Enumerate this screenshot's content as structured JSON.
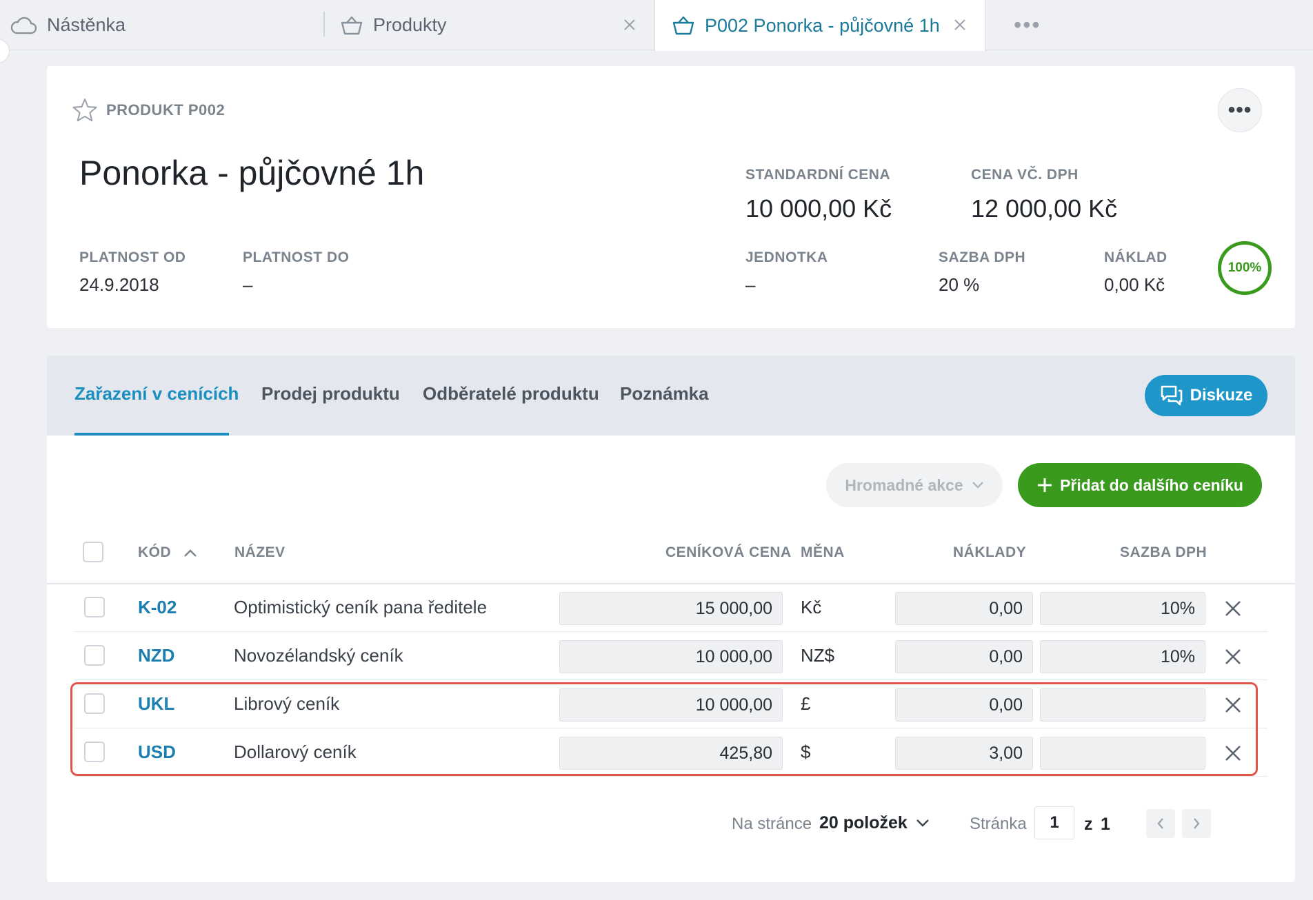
{
  "tabs": {
    "dashboard": "Nástěnka",
    "products": "Produkty",
    "active": "P002 Ponorka - půjčovné 1h",
    "more": "•••"
  },
  "header": {
    "breadcrumb": "PRODUKT P002",
    "more": "•••",
    "title": "Ponorka - půjčovné 1h",
    "standard_price_label": "STANDARDNÍ CENA",
    "standard_price": "10 000,00 Kč",
    "price_vat_label": "CENA VČ. DPH",
    "price_vat": "12 000,00 Kč",
    "valid_from_label": "PLATNOST OD",
    "valid_from": "24.9.2018",
    "valid_to_label": "PLATNOST DO",
    "valid_to": "–",
    "unit_label": "JEDNOTKA",
    "unit": "–",
    "vat_rate_label": "SAZBA DPH",
    "vat_rate": "20 %",
    "cost_label": "NÁKLAD",
    "cost": "0,00 Kč",
    "completeness": "100%"
  },
  "panel": {
    "tabs": [
      "Zařazení v cenících",
      "Prodej produktu",
      "Odběratelé produktu",
      "Poznámka"
    ],
    "discussion": "Diskuze",
    "bulk_actions": "Hromadné akce",
    "add_pricelist": "Přidat do dalšího ceníku"
  },
  "table": {
    "headers": {
      "code": "KÓD",
      "name": "NÁZEV",
      "price": "CENÍKOVÁ CENA",
      "currency": "MĚNA",
      "costs": "NÁKLADY",
      "vat": "SAZBA DPH"
    },
    "rows": [
      {
        "code": "K-02",
        "name": "Optimistický ceník pana ředitele",
        "price": "15 000,00",
        "currency": "Kč",
        "costs": "0,00",
        "vat": "10%"
      },
      {
        "code": "NZD",
        "name": "Novozélandský ceník",
        "price": "10 000,00",
        "currency": "NZ$",
        "costs": "0,00",
        "vat": "10%"
      },
      {
        "code": "UKL",
        "name": "Librový ceník",
        "price": "10 000,00",
        "currency": "£",
        "costs": "0,00",
        "vat": ""
      },
      {
        "code": "USD",
        "name": "Dollarový ceník",
        "price": "425,80",
        "currency": "$",
        "costs": "3,00",
        "vat": ""
      }
    ]
  },
  "pager": {
    "per_page_label": "Na stránce",
    "per_page_value": "20 položek",
    "page_label": "Stránka",
    "page": "1",
    "of_label": "z",
    "total_pages": "1"
  },
  "colors": {
    "accent_blue": "#1a8fbf",
    "green": "#3a9a1e",
    "highlight_red": "#e0574a"
  }
}
